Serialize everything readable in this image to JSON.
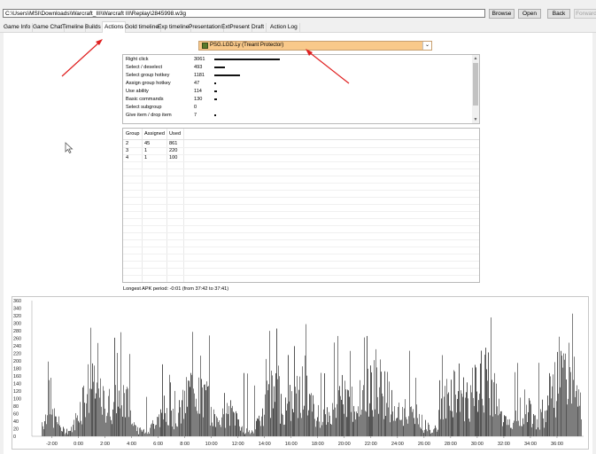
{
  "path": "C:\\Users\\MSI\\Downloads\\Warcraft_III\\Warcraft III\\Replay\\2845998.w3g",
  "toolbar": {
    "browse": "Browse",
    "open": "Open",
    "back": "Back",
    "forward": "Forward"
  },
  "tabs": [
    "Game Info",
    "Game Chat",
    "Timeline",
    "Builds",
    "Actions",
    "Gold timeline",
    "Exp timeline",
    "Presentation",
    "ExtPresent",
    "Draft",
    "Action Log"
  ],
  "active_tab": "Actions",
  "player": "PSG.LGD.Ly (Treant Protector)",
  "actions": [
    {
      "name": "Right click",
      "value": "3061",
      "ratio": 1.0
    },
    {
      "name": "Select / deselect",
      "value": "493",
      "ratio": 0.161
    },
    {
      "name": "Select group hotkey",
      "value": "1181",
      "ratio": 0.386
    },
    {
      "name": "Assign group hotkey",
      "value": "47",
      "ratio": 0.015
    },
    {
      "name": "Use ability",
      "value": "114",
      "ratio": 0.037
    },
    {
      "name": "Basic commands",
      "value": "130",
      "ratio": 0.042
    },
    {
      "name": "Select subgroup",
      "value": "0",
      "ratio": 0
    },
    {
      "name": "Give item / drop item",
      "value": "7",
      "ratio": 0.002
    }
  ],
  "groups": {
    "headers": [
      "Group",
      "Assigned",
      "Used"
    ],
    "rows": [
      [
        "2",
        "45",
        "861"
      ],
      [
        "3",
        "1",
        "220"
      ],
      [
        "4",
        "1",
        "100"
      ]
    ]
  },
  "apk_text": "Longest APK period: -0:01 (from 37:42 to 37:41)",
  "chart_data": {
    "type": "bar",
    "ylim": [
      0,
      360
    ],
    "y_ticks": [
      "0",
      "20",
      "40",
      "60",
      "80",
      "100",
      "120",
      "140",
      "160",
      "180",
      "200",
      "220",
      "240",
      "260",
      "280",
      "300",
      "320",
      "340",
      "360"
    ],
    "x_ticks": [
      "-2:00",
      "0:00",
      "2:00",
      "4:00",
      "6:00",
      "8:00",
      "10:00",
      "12:00",
      "14:00",
      "16:00",
      "18:00",
      "20:00",
      "22:00",
      "24:00",
      "26:00",
      "28:00",
      "30:00",
      "32:00",
      "34:00",
      "36:00"
    ],
    "x_range_minutes": [
      -3.5,
      38
    ],
    "colors": {
      "bars": "#7d7d7d",
      "dark": "#555555"
    }
  }
}
